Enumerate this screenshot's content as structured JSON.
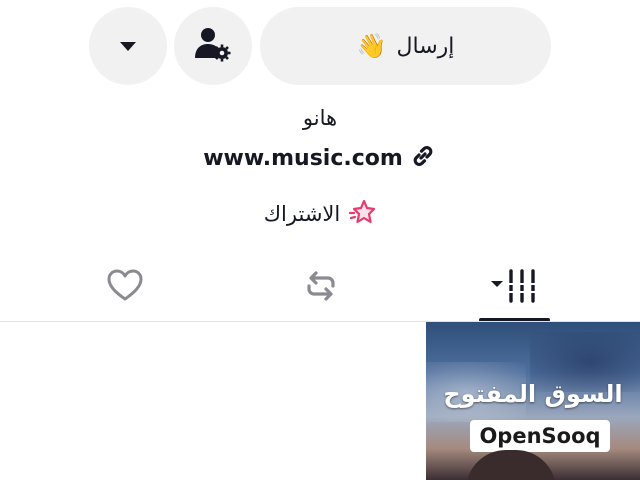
{
  "actions": {
    "send_label": "إرسال",
    "send_emoji": "👋"
  },
  "profile": {
    "bio": "هانو",
    "link": "www.music.com",
    "subscribe_label": "الاشتراك"
  },
  "tabs": [
    {
      "name": "videos",
      "icon": "grid-bars-icon",
      "active": true
    },
    {
      "name": "reposts",
      "icon": "repost-icon",
      "active": false
    },
    {
      "name": "likes",
      "icon": "heart-icon",
      "active": false
    }
  ],
  "ad": {
    "arabic_title": "السوق المفتوح",
    "brand": "OpenSooq"
  },
  "colors": {
    "text": "#161823",
    "pill_bg": "#f1f1f2",
    "accent": "#e83b6d"
  }
}
